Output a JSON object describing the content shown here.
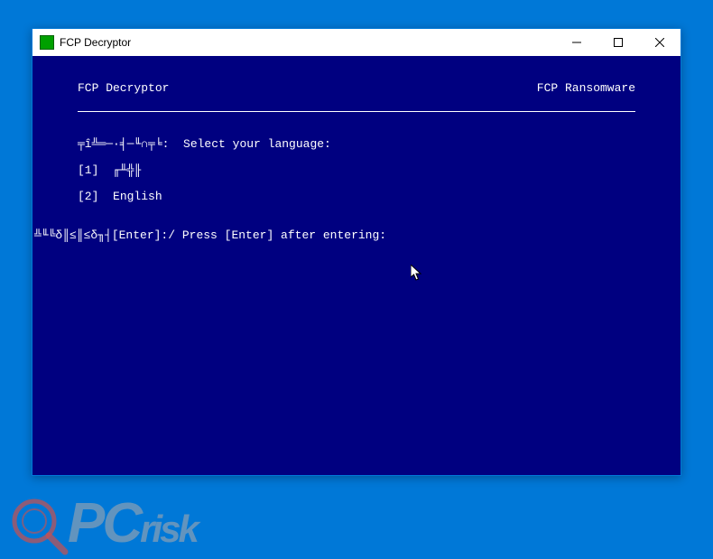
{
  "window": {
    "title": "FCP Decryptor"
  },
  "header": {
    "left": "FCP Decryptor",
    "right": "FCP Ransomware"
  },
  "prompts": {
    "lang_select_cjk": "╤î╩═─·╡─╙∩╤╘:",
    "lang_select_en": "Select your language:",
    "enter_cjk": "╩╙╚δ║≤║≤δ╖┤",
    "enter_en": "[Enter]:/ Press [Enter] after entering:"
  },
  "options": [
    {
      "num": "[1]",
      "label": "╓╨╬╟"
    },
    {
      "num": "[2]",
      "label": "English"
    }
  ],
  "watermark": {
    "brand_prefix": "PC",
    "brand_suffix": "risk"
  }
}
